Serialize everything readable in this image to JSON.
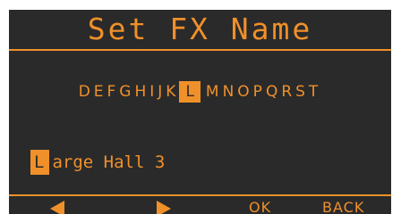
{
  "screen": {
    "title": "Set FX Name"
  },
  "alphabet": {
    "before": "DEFGHIJK",
    "selected": "L",
    "after": "MNOPQRST"
  },
  "name_entry": {
    "cursor_char": "L",
    "rest": "arge Hall 3"
  },
  "softkeys": {
    "left_icon": "left-triangle-icon",
    "right_icon": "right-triangle-icon",
    "ok_label": "OK",
    "back_label": "BACK"
  },
  "colors": {
    "accent": "#f0902a",
    "background": "#2a2a2a"
  }
}
